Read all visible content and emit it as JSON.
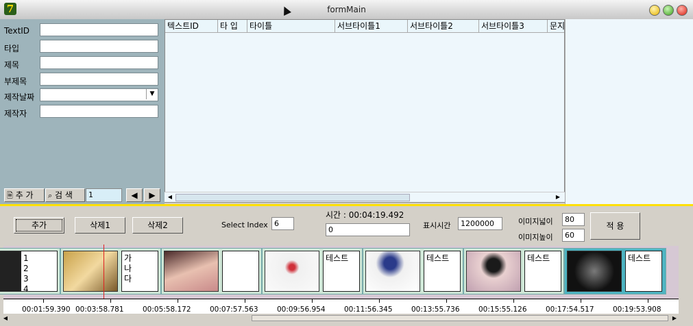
{
  "window": {
    "title": "formMain",
    "app_icon": "7"
  },
  "form": {
    "fields": [
      {
        "label": "TextID",
        "value": ""
      },
      {
        "label": "타입",
        "value": ""
      },
      {
        "label": "제목",
        "value": ""
      },
      {
        "label": "부제목",
        "value": ""
      },
      {
        "label": "제작날짜",
        "value": ""
      },
      {
        "label": "제작자",
        "value": ""
      }
    ],
    "add_button": "추 가",
    "search_button": "검 색",
    "index_value": "1"
  },
  "grid": {
    "columns": [
      "텍스트ID",
      "타 입",
      "타이틀",
      "서브타이틀1",
      "서브타이틀2",
      "서브타이틀3",
      "문지"
    ]
  },
  "controls": {
    "add_label": "추가",
    "delete1_label": "삭제1",
    "delete2_label": "삭제2",
    "select_index_label": "Select Index",
    "select_index_value": "6",
    "time_label": "시간 : 00:04:19.492",
    "time_input_value": "0",
    "display_time_label": "표시시간",
    "display_time_value": "1200000",
    "image_width_label": "이미지넓이",
    "image_width_value": "80",
    "image_height_label": "이미지높이",
    "image_height_value": "60",
    "apply_label": "적 용"
  },
  "thumbnails": [
    {
      "text": "1\n2\n3\n4"
    },
    {
      "text": "가\n나\n다"
    },
    {
      "text": ""
    },
    {
      "text": "테스트"
    },
    {
      "text": "테스트"
    },
    {
      "text": "테스트"
    },
    {
      "text": "테스트"
    }
  ],
  "timeline": {
    "labels": [
      "00:01:59.390",
      "00:03:58.781",
      "00:05:58.172",
      "00:07:57.563",
      "00:09:56.954",
      "00:11:56.345",
      "00:13:55.736",
      "00:15:55.126",
      "00:17:54.517",
      "00:19:53.908"
    ]
  },
  "colors": {
    "accent": "#ffe000",
    "panel": "#9eb4bb",
    "playhead": "#e02020"
  }
}
